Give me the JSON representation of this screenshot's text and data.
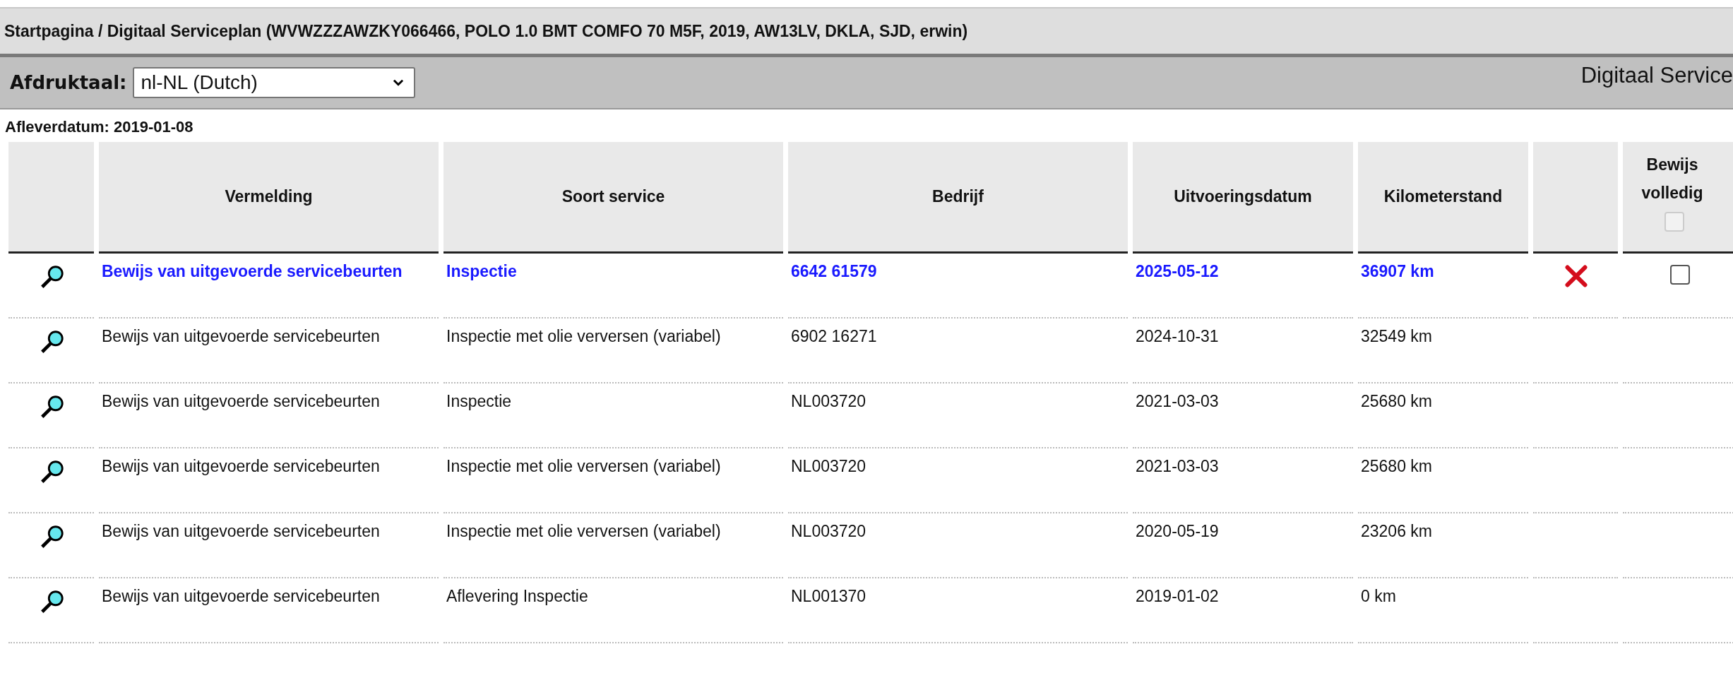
{
  "breadcrumb": "Startpagina / Digitaal Serviceplan (WVWZZZAWZKY066466, POLO 1.0 BMT COMFO 70 M5F, 2019, AW13LV, DKLA, SJD, erwin)",
  "toolbar": {
    "language_label": "Afdruktaal:",
    "language_value": "nl-NL (Dutch)",
    "title": "Digitaal Service"
  },
  "delivery_date": "Afleverdatum: 2019-01-08",
  "table": {
    "columns": [
      "Vermelding",
      "Soort service",
      "Bedrijf",
      "Uitvoeringsdatum",
      "Kilometerstand"
    ],
    "proof_column": {
      "label_line_1": "Bewijs",
      "label_line_2": "volledig",
      "checked": false,
      "disabled": true
    },
    "rows": [
      {
        "highlighted": true,
        "deletable": true,
        "proof_checked": false,
        "cells": [
          "Bewijs van uitgevoerde servicebeurten",
          "Inspectie",
          "6642 61579",
          "2025-05-12",
          "36907 km"
        ]
      },
      {
        "highlighted": false,
        "deletable": false,
        "cells": [
          "Bewijs van uitgevoerde servicebeurten",
          "Inspectie met olie verversen (variabel)",
          "6902 16271",
          "2024-10-31",
          "32549 km"
        ]
      },
      {
        "highlighted": false,
        "deletable": false,
        "cells": [
          "Bewijs van uitgevoerde servicebeurten",
          "Inspectie",
          "NL003720",
          "2021-03-03",
          "25680 km"
        ]
      },
      {
        "highlighted": false,
        "deletable": false,
        "cells": [
          "Bewijs van uitgevoerde servicebeurten",
          "Inspectie met olie verversen (variabel)",
          "NL003720",
          "2021-03-03",
          "25680 km"
        ]
      },
      {
        "highlighted": false,
        "deletable": false,
        "cells": [
          "Bewijs van uitgevoerde servicebeurten",
          "Inspectie met olie verversen (variabel)",
          "NL003720",
          "2020-05-19",
          "23206 km"
        ]
      },
      {
        "highlighted": false,
        "deletable": false,
        "cells": [
          "Bewijs van uitgevoerde servicebeurten",
          "Aflevering Inspectie",
          "NL001370",
          "2019-01-02",
          "0 km"
        ]
      }
    ]
  }
}
